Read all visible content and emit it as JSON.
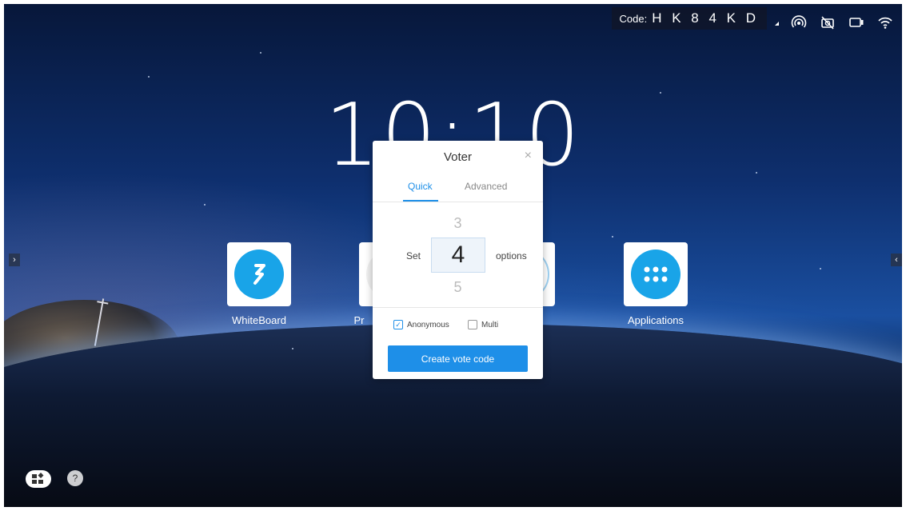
{
  "status_bar": {
    "code_label": "Code:",
    "code_value": "H K 8 4 K D",
    "icons": [
      "hotspot-icon",
      "camera-off-icon",
      "screen-share-icon",
      "wifi-icon"
    ]
  },
  "clock": {
    "time": "10:10"
  },
  "apps": [
    {
      "label": "WhiteBoard",
      "icon": "whiteboard-icon"
    },
    {
      "label": "Pr",
      "icon": "partial-app-icon"
    },
    {
      "label": "Applications",
      "icon": "applications-grid-icon"
    }
  ],
  "side_arrows": {
    "left": "›",
    "right": "‹"
  },
  "bottom": {
    "help": "?"
  },
  "dialog": {
    "title": "Voter",
    "close": "×",
    "tabs": [
      {
        "label": "Quick",
        "active": true
      },
      {
        "label": "Advanced",
        "active": false
      }
    ],
    "picker": {
      "prev": "3",
      "current": "4",
      "next": "5"
    },
    "set_label": "Set",
    "options_label": "options",
    "anonymous_label": "Anonymous",
    "anonymous_checked": true,
    "multi_label": "Multi",
    "multi_checked": false,
    "create_button": "Create vote code"
  },
  "colors": {
    "accent": "#1e8fe8",
    "app_icon": "#19a4e8"
  }
}
